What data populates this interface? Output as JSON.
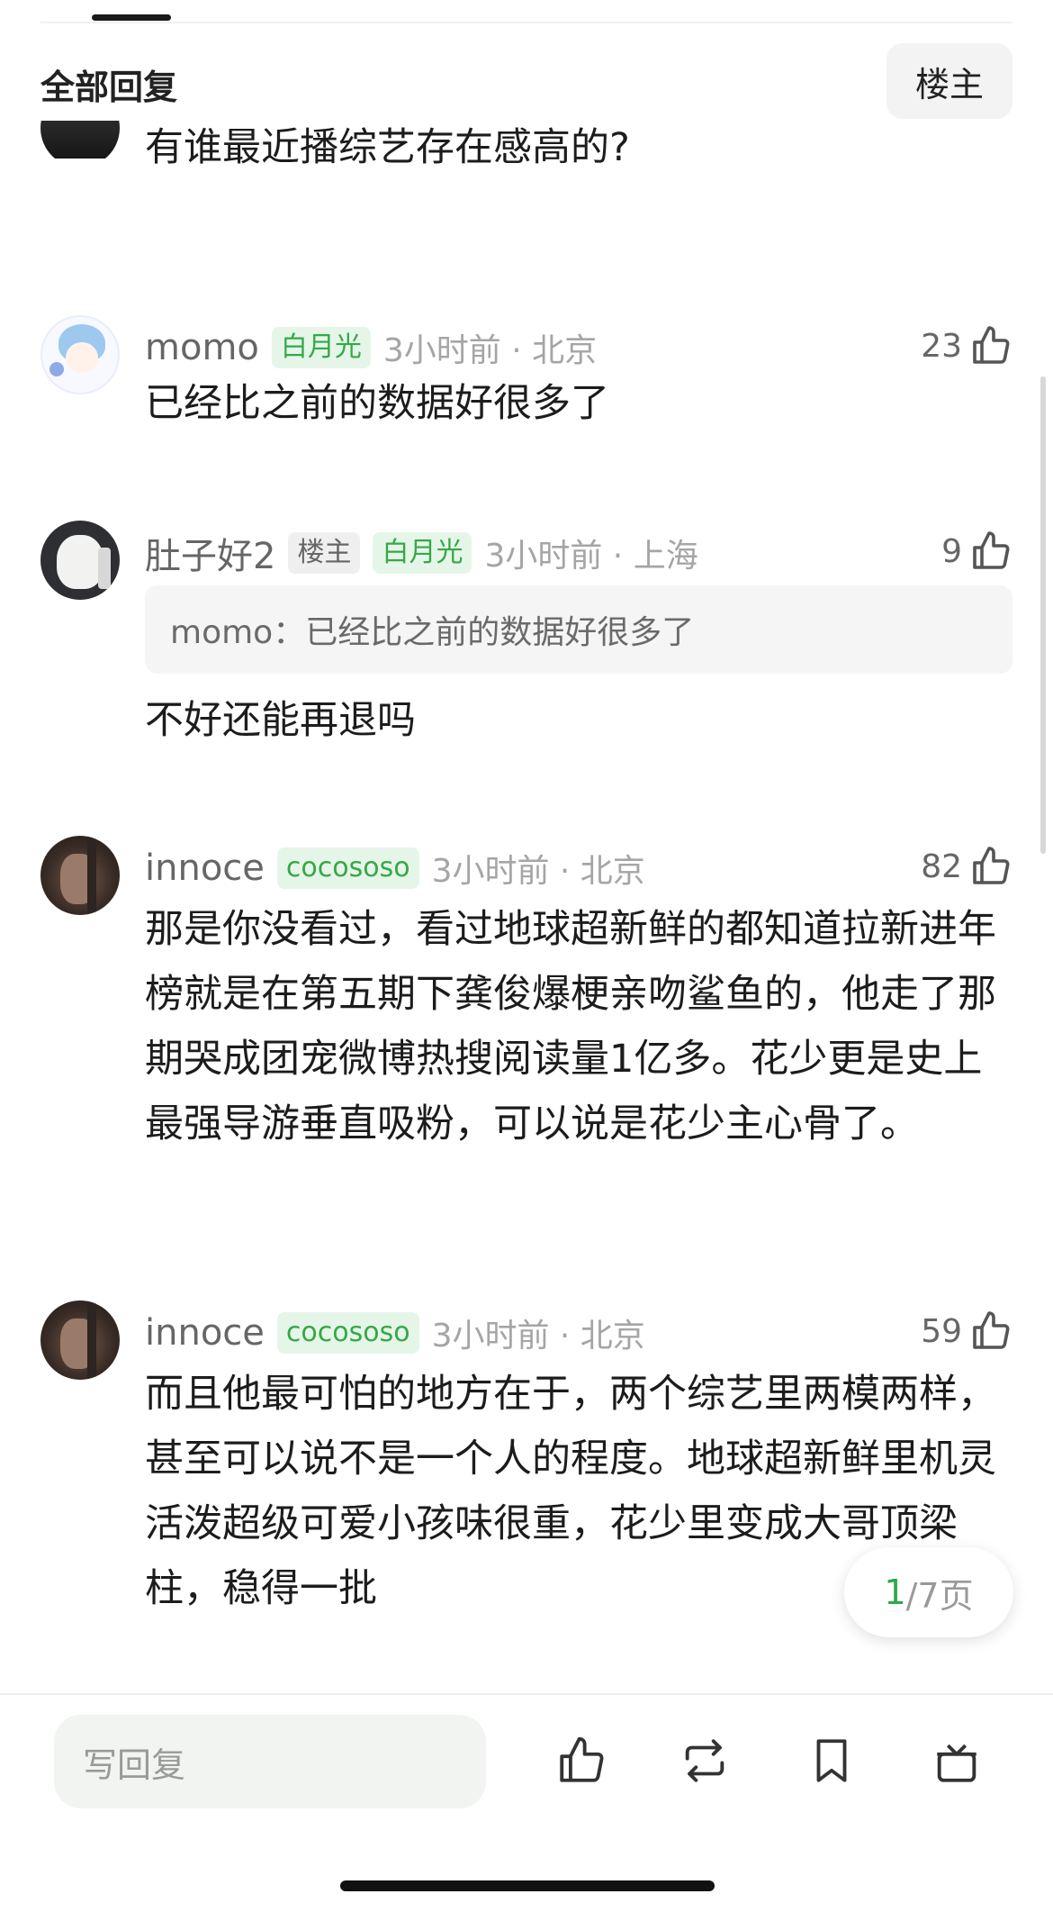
{
  "header": {
    "title": "全部回复",
    "op_filter_label": "楼主"
  },
  "cutoff_comment": {
    "text": "有谁最近播综艺存在感高的?"
  },
  "comments": [
    {
      "user": "momo",
      "badges": [
        {
          "text": "白月光",
          "style": "green"
        }
      ],
      "time_location": "3小时前 · 北京",
      "likes": "23",
      "text": "已经比之前的数据好很多了"
    },
    {
      "user": "肚子好2",
      "badges": [
        {
          "text": "楼主",
          "style": "gray"
        },
        {
          "text": "白月光",
          "style": "green"
        }
      ],
      "time_location": "3小时前 · 上海",
      "likes": "9",
      "quote": "momo：已经比之前的数据好很多了",
      "text": "不好还能再退吗"
    },
    {
      "user": "innoce",
      "badges": [
        {
          "text": "cocososo",
          "style": "green"
        }
      ],
      "time_location": "3小时前 · 北京",
      "likes": "82",
      "text": "那是你没看过，看过地球超新鲜的都知道拉新进年榜就是在第五期下龚俊爆梗亲吻鲨鱼的，他走了那期哭成团宠微博热搜阅读量1亿多。花少更是史上最强导游垂直吸粉，可以说是花少主心骨了。"
    },
    {
      "user": "innoce",
      "badges": [
        {
          "text": "cocososo",
          "style": "green"
        }
      ],
      "time_location": "3小时前 · 北京",
      "likes": "59",
      "text": "而且他最可怕的地方在于，两个综艺里两模两样，甚至可以说不是一个人的程度。地球超新鲜里机灵活泼超级可爱小孩味很重，花少里变成大哥顶梁柱，稳得一批"
    }
  ],
  "pager": {
    "current": "1",
    "total_suffix": "/7页"
  },
  "bottom_bar": {
    "reply_placeholder": "写回复",
    "icons": [
      "thumbs-up-icon",
      "repost-icon",
      "bookmark-icon",
      "gift-icon"
    ]
  },
  "colors": {
    "accent_green": "#35a848",
    "badge_green_bg": "#e5f6e8",
    "meta_gray": "#a5a5a5"
  }
}
